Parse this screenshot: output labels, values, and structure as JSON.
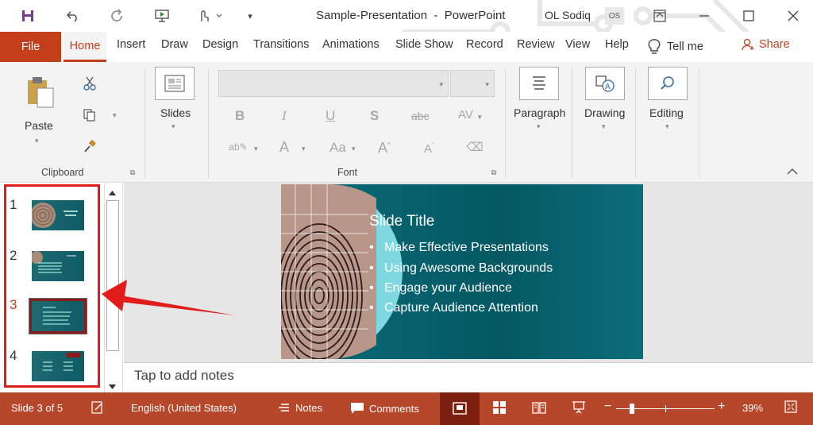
{
  "titlebar": {
    "doc_title": "Sample-Presentation",
    "separator": "-",
    "app_name": "PowerPoint",
    "user_name": "OL Sodiq",
    "avatar_initials": "OS",
    "icons": [
      "save-icon",
      "undo-icon",
      "redo-icon",
      "present-from-beginning-icon",
      "touch-mode-icon",
      "customize-qat-icon",
      "ribbon-display-options-icon",
      "minimize-icon",
      "maximize-icon",
      "close-icon"
    ]
  },
  "tabs": {
    "file": "File",
    "items": [
      "Home",
      "Insert",
      "Draw",
      "Design",
      "Transitions",
      "Animations",
      "Slide Show",
      "Record",
      "Review",
      "View",
      "Help"
    ],
    "tell_me": "Tell me",
    "share": "Share"
  },
  "ribbon": {
    "clipboard": {
      "paste": "Paste",
      "label": "Clipboard"
    },
    "slides": {
      "label": "Slides"
    },
    "font": {
      "label": "Font",
      "bold": "B",
      "italic": "I",
      "underline": "U",
      "shadow": "S",
      "strike": "abc",
      "spacing": "AV",
      "font_color": "A",
      "change_case": "Aa",
      "grow": "A",
      "shrink": "A"
    },
    "paragraph": {
      "label": "Paragraph"
    },
    "drawing": {
      "label": "Drawing"
    },
    "editing": {
      "label": "Editing"
    }
  },
  "thumbnails": {
    "numbers": [
      "1",
      "2",
      "3",
      "4"
    ],
    "selected_index": 3
  },
  "slide": {
    "title": "Slide Title",
    "bullets": [
      "Make Effective Presentations",
      "Using Awesome Backgrounds",
      "Engage your Audience",
      "Capture Audience Attention"
    ]
  },
  "notes": {
    "placeholder": "Tap to add notes"
  },
  "statusbar": {
    "slide_info": "Slide 3 of 5",
    "language": "English (United States)",
    "notes": "Notes",
    "comments": "Comments",
    "zoom_minus": "−",
    "zoom_plus": "+",
    "zoom_percent": "39%",
    "zoom_value": 0.39
  },
  "colors": {
    "accent": "#c43e1c",
    "statusbar": "#b7472a",
    "highlight": "#e21b1b",
    "slide_bg": "#0a6d7a"
  }
}
